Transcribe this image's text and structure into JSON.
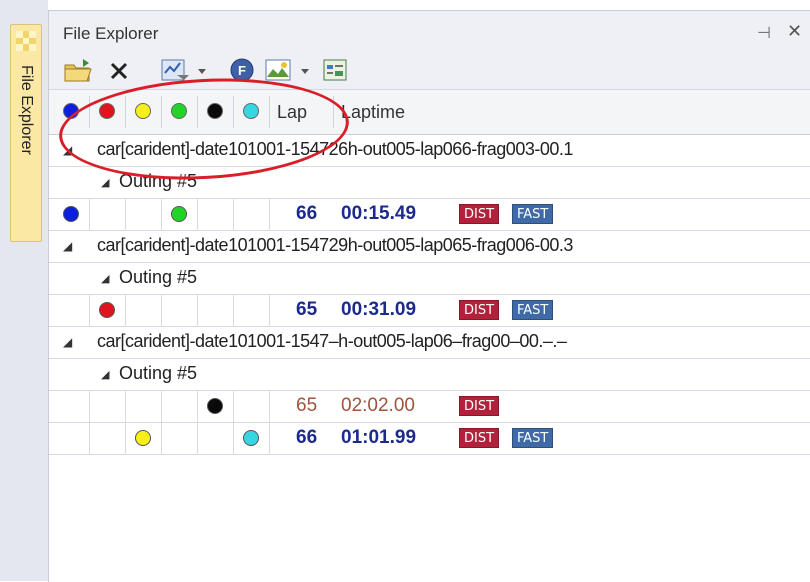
{
  "sidebar": {
    "tab_label": "File Explorer",
    "tab_icon": "checker-icon"
  },
  "panel": {
    "title": "File Explorer",
    "pin_glyph": "⊣",
    "close_glyph": "✕"
  },
  "toolbar": {
    "icons": [
      "open-folder-icon",
      "delete-icon",
      "filter-icon",
      "dropdown-arrow-icon",
      "f-circle-icon",
      "chart-image-icon",
      "dropdown-arrow-icon",
      "report-icon"
    ]
  },
  "header": {
    "dot_colors": [
      "#0b1fdc",
      "#e0141c",
      "#f7ef1a",
      "#22d42a",
      "#0a0a0a",
      "#36d7e3"
    ],
    "lap_label": "Lap",
    "laptime_label": "Laptime"
  },
  "colors": {
    "lap_fast": "#1c2a8c",
    "lap_slow": "#a2523c",
    "dist": "#b0223a",
    "fast": "#3f6aa8"
  },
  "groups": [
    {
      "file": "car[carident]-date101001-154726h-out005-lap066-frag003-00.1",
      "outing": "Outing #5",
      "laps": [
        {
          "lap": "66",
          "time": "00:15.49",
          "dist": "DIST",
          "fast": "FAST",
          "dots": [
            0,
            3
          ]
        }
      ]
    },
    {
      "file": "car[carident]-date101001-154729h-out005-lap065-frag006-00.3",
      "outing": "Outing #5",
      "laps": [
        {
          "lap": "65",
          "time": "00:31.09",
          "dist": "DIST",
          "fast": "FAST",
          "dots": [
            1
          ]
        }
      ]
    },
    {
      "file": "car[carident]-date101001-1547–h-out005-lap06–frag00–00.–.–",
      "outing": "Outing #5",
      "laps": [
        {
          "lap": "65",
          "time": "02:02.00",
          "dist": "DIST",
          "fast": "",
          "dots": [
            4
          ]
        },
        {
          "lap": "66",
          "time": "01:01.99",
          "dist": "DIST",
          "fast": "FAST",
          "dots": [
            2,
            5
          ]
        }
      ]
    }
  ]
}
